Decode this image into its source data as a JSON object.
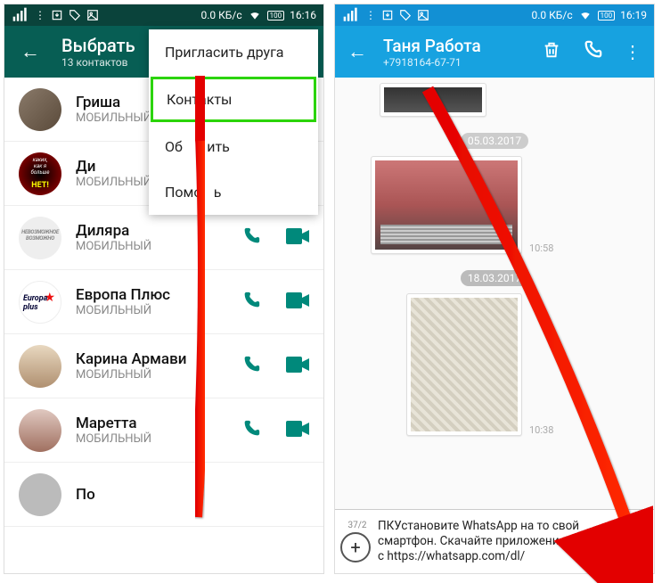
{
  "phone1": {
    "statusbar": {
      "data": "0.0 КБ/с",
      "battery": "100",
      "time": "16:16"
    },
    "header": {
      "title": "Выбрать",
      "subtitle": "13 контактов"
    },
    "menu": {
      "items": [
        "Пригласить друга",
        "Контакты",
        "Обновить",
        "Помощь"
      ],
      "overlaid": {
        "item2": "Об",
        "item2b": "ить",
        "item3": "Помо",
        "item3b": "ь"
      }
    },
    "contacts": [
      {
        "name": "Гриша",
        "type": "МОБИЛЬНЫЙ"
      },
      {
        "name": "Ди",
        "type": "МОБИЛЬНЫЙ"
      },
      {
        "name": "Диляра",
        "type": "МОБИЛЬНЫЙ"
      },
      {
        "name": "Европа Плюс",
        "type": "МОБИЛЬНЫЙ"
      },
      {
        "name": "Карина Армави",
        "type": "МОБИЛЬНЫЙ"
      },
      {
        "name": "Маретта",
        "type": "МОБИЛЬНЫЙ"
      },
      {
        "name": "По",
        "type": ""
      }
    ]
  },
  "phone2": {
    "statusbar": {
      "data": "0.0 КБ/с",
      "battery": "100",
      "time": "16:19"
    },
    "header": {
      "title": "Таня Работа",
      "subtitle": "+7918164-67-71"
    },
    "dates": [
      "05.03.2017",
      "18.03.2017"
    ],
    "times": [
      "10:58",
      "10:38"
    ],
    "compose": {
      "counter": "37/2",
      "text": "ПКУстановите WhatsApp на то свой смартфон. Скачайте приложение сегодня с https://whatsapp.com/dl/"
    }
  }
}
